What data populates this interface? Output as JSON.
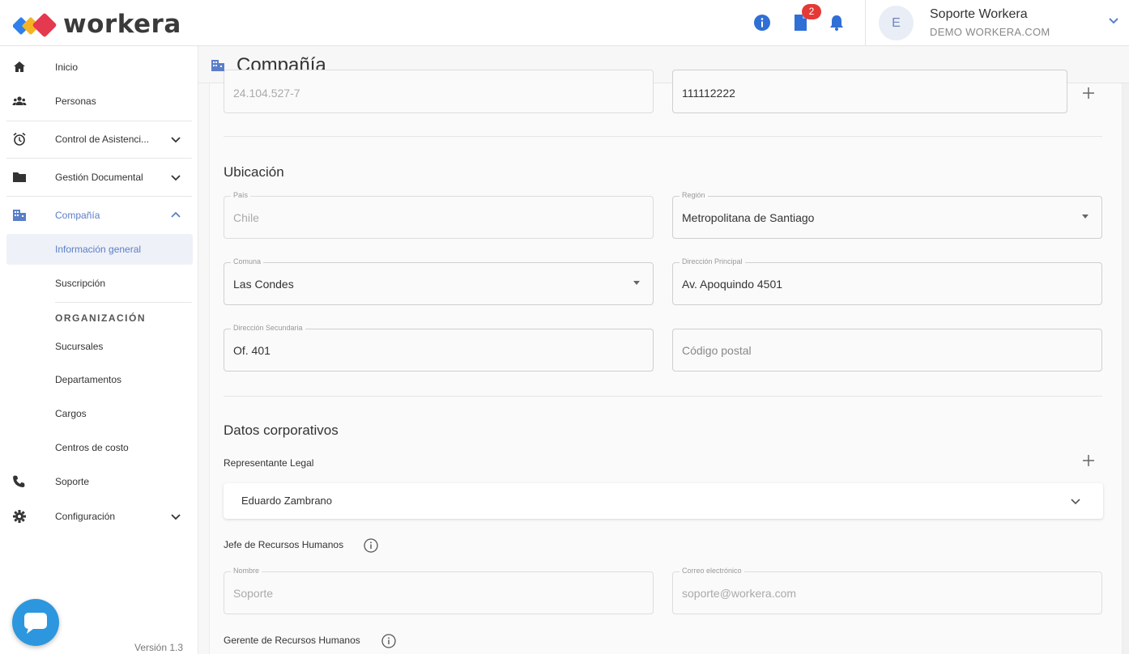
{
  "header": {
    "logo_text": "workera",
    "notification_count": "2",
    "user": {
      "avatar_initial": "E",
      "name": "Soporte Workera",
      "company": "DEMO WORKERA.COM"
    }
  },
  "sidebar": {
    "items": {
      "inicio": "Inicio",
      "personas": "Personas",
      "asistencia": "Control de Asistenci...",
      "documental": "Gestión Documental",
      "compania": "Compañía",
      "soporte": "Soporte",
      "configuracion": "Configuración"
    },
    "sub_items": {
      "info_general": "Información general",
      "suscripcion": "Suscripción",
      "sucursales": "Sucursales",
      "departamentos": "Departamentos",
      "cargos": "Cargos",
      "centros_costo": "Centros de costo"
    },
    "section_title": "ORGANIZACIÓN",
    "version": "Versión 1.3"
  },
  "page": {
    "title": "Compañía"
  },
  "form": {
    "top_row": {
      "left_value": "24.104.527-7",
      "right_value": "111112222"
    },
    "ubicacion": {
      "heading": "Ubicación",
      "pais_label": "País",
      "pais_value": "Chile",
      "region_label": "Región",
      "region_value": "Metropolitana de Santiago",
      "comuna_label": "Comuna",
      "comuna_value": "Las Condes",
      "direccion_label": "Dirección Principal",
      "direccion_value": "Av. Apoquindo 4501",
      "direccion2_label": "Dirección Secundaria",
      "direccion2_value": "Of. 401",
      "postal_placeholder": "Código postal"
    },
    "corporativos": {
      "heading": "Datos corporativos",
      "representante_label": "Representante Legal",
      "representante_value": "Eduardo Zambrano",
      "jefe_rrhh_label": "Jefe de Recursos Humanos",
      "nombre_label": "Nombre",
      "nombre_value": "Soporte",
      "correo_label": "Correo electrónico",
      "correo_value": "soporte@workera.com",
      "gerente_rrhh_label": "Gerente de Recursos Humanos"
    }
  },
  "colors": {
    "accent": "#5b7ec9",
    "icon_blue": "#2f6fd6",
    "badge_red": "#e53935",
    "chat_blue": "#2c97de"
  }
}
